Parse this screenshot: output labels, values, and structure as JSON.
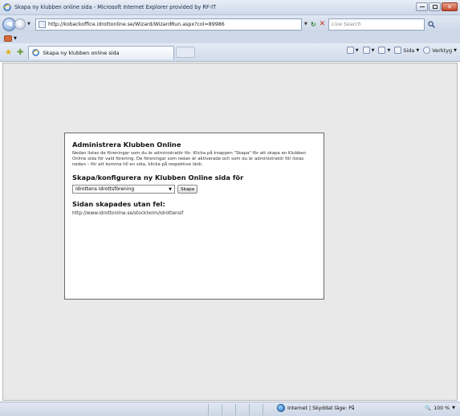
{
  "window": {
    "title": "Skapa ny klubben online sida - Microsoft Internet Explorer provided by RF-IT"
  },
  "address_bar": {
    "url": "http://kobackoffice.idrottonline.se/Wizard/WizardRun.aspx?col=89986",
    "search_placeholder": "Live Search"
  },
  "tab": {
    "title": "Skapa ny klubben online sida"
  },
  "command_bar": {
    "page_label": "Sida",
    "tools_label": "Verktyg"
  },
  "panel": {
    "heading": "Administrera Klubben Online",
    "intro": "Nedan listas de föreningar som du är administratör för. Klicka på knappen \"Skapa\" för att skapa en Klubben Online sida för vald förening. De föreningar som redan är aktiverade och som du är administratör för listas nedan – för att komma till en sida, klicka på respektive länk.",
    "subheading": "Skapa/konfigurera ny Klubben Online sida för",
    "select_value": "Idrottens Idrottsförening",
    "create_button": "Skapa",
    "result_heading": "Sidan skapades utan fel:",
    "result_url": "http://www.idrottonline.se/stockholm/idrottensif"
  },
  "status_bar": {
    "zone": "Internet | Skyddat läge: På",
    "zoom": "100 %"
  }
}
